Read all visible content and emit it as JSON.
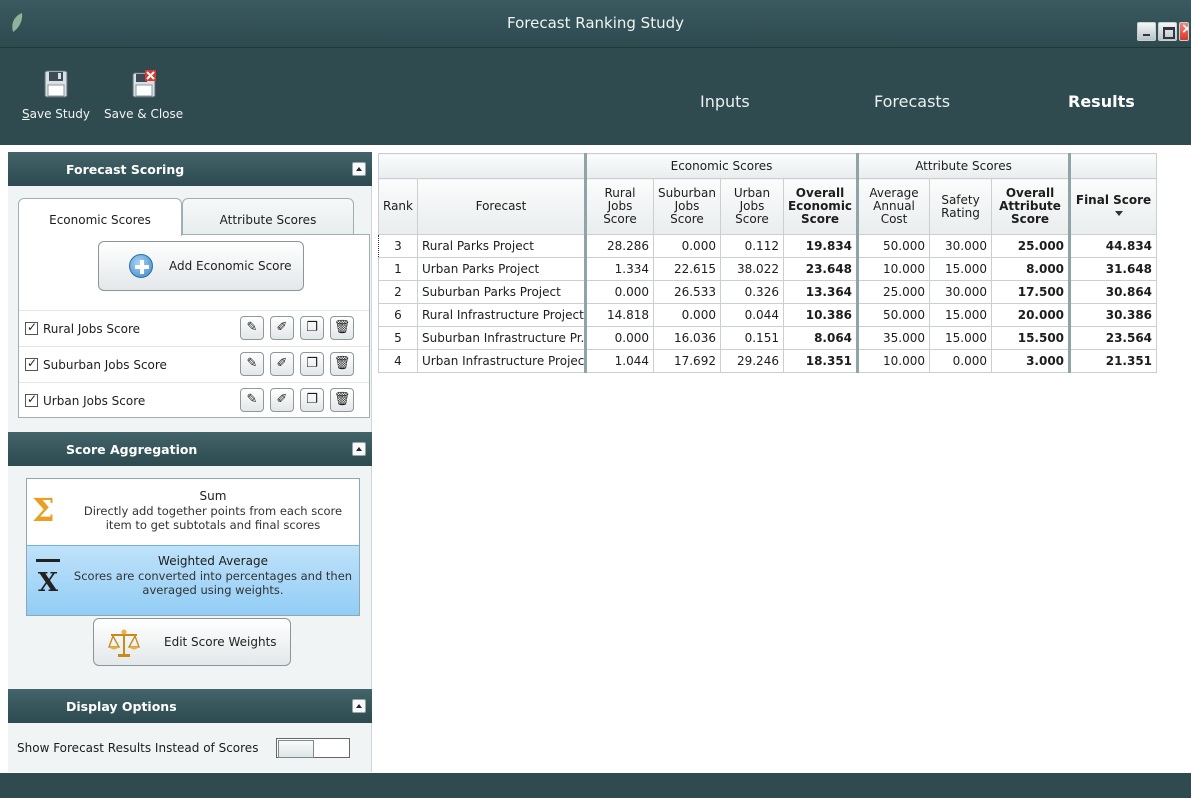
{
  "window": {
    "title": "Forecast Ranking Study"
  },
  "toolbar": {
    "save_study": "ave Study",
    "save_study_mnemonic": "S",
    "save_close": "Save & Close"
  },
  "nav": {
    "inputs": "Inputs",
    "forecasts": "Forecasts",
    "results": "Results",
    "active": "Results"
  },
  "forecast_scoring": {
    "header": "Forecast Scoring",
    "tabs": [
      "Economic Scores",
      "Attribute Scores"
    ],
    "active_tab": "Economic Scores",
    "add_button": "Add Economic Score",
    "items": [
      {
        "label": "Rural Jobs Score",
        "checked": true
      },
      {
        "label": "Suburban Jobs Score",
        "checked": true
      },
      {
        "label": "Urban Jobs Score",
        "checked": true
      }
    ]
  },
  "score_aggregation": {
    "header": "Score Aggregation",
    "options": [
      {
        "title": "Sum",
        "desc": "Directly add together points from each score item to get subtotals and final scores"
      },
      {
        "title": "Weighted Average",
        "desc": "Scores are converted into percentages and then averaged using weights."
      }
    ],
    "selected": "Weighted Average",
    "edit_weights": "Edit Score Weights"
  },
  "display_options": {
    "header": "Display Options",
    "toggle_label": "Show Forecast Results Instead of Scores",
    "toggle_on": false
  },
  "grid": {
    "groups": {
      "economic": "Economic Scores",
      "attribute": "Attribute Scores"
    },
    "columns": {
      "rank": "Rank",
      "forecast": "Forecast",
      "rural": "Rural Jobs Score",
      "suburban": "Suburban Jobs Score",
      "urban": "Urban Jobs Score",
      "overall_econ": "Overall Economic Score",
      "avg_cost": "Average Annual Cost",
      "safety": "Safety Rating",
      "overall_attr": "Overall Attribute Score",
      "final": "Final Score"
    },
    "rows": [
      {
        "rank": "3",
        "forecast": "Rural Parks Project",
        "rural": "28.286",
        "suburban": "0.000",
        "urban": "0.112",
        "overall_econ": "19.834",
        "avg_cost": "50.000",
        "safety": "30.000",
        "overall_attr": "25.000",
        "final": "44.834"
      },
      {
        "rank": "1",
        "forecast": "Urban Parks Project",
        "rural": "1.334",
        "suburban": "22.615",
        "urban": "38.022",
        "overall_econ": "23.648",
        "avg_cost": "10.000",
        "safety": "15.000",
        "overall_attr": "8.000",
        "final": "31.648"
      },
      {
        "rank": "2",
        "forecast": "Suburban Parks Project",
        "rural": "0.000",
        "suburban": "26.533",
        "urban": "0.326",
        "overall_econ": "13.364",
        "avg_cost": "25.000",
        "safety": "30.000",
        "overall_attr": "17.500",
        "final": "30.864"
      },
      {
        "rank": "6",
        "forecast": "Rural Infrastructure Project",
        "rural": "14.818",
        "suburban": "0.000",
        "urban": "0.044",
        "overall_econ": "10.386",
        "avg_cost": "50.000",
        "safety": "15.000",
        "overall_attr": "20.000",
        "final": "30.386"
      },
      {
        "rank": "5",
        "forecast": "Suburban Infrastructure Pr...",
        "rural": "0.000",
        "suburban": "16.036",
        "urban": "0.151",
        "overall_econ": "8.064",
        "avg_cost": "35.000",
        "safety": "15.000",
        "overall_attr": "15.500",
        "final": "23.564"
      },
      {
        "rank": "4",
        "forecast": "Urban Infrastructure Project",
        "rural": "1.044",
        "suburban": "17.692",
        "urban": "29.246",
        "overall_econ": "18.351",
        "avg_cost": "10.000",
        "safety": "0.000",
        "overall_attr": "3.000",
        "final": "21.351"
      }
    ],
    "sort_column": "final",
    "sort_direction": "descending"
  },
  "colors": {
    "chrome": "#2f4b4f",
    "panel_header": "#3b5b60",
    "selected_option": "#a9d8f7"
  }
}
